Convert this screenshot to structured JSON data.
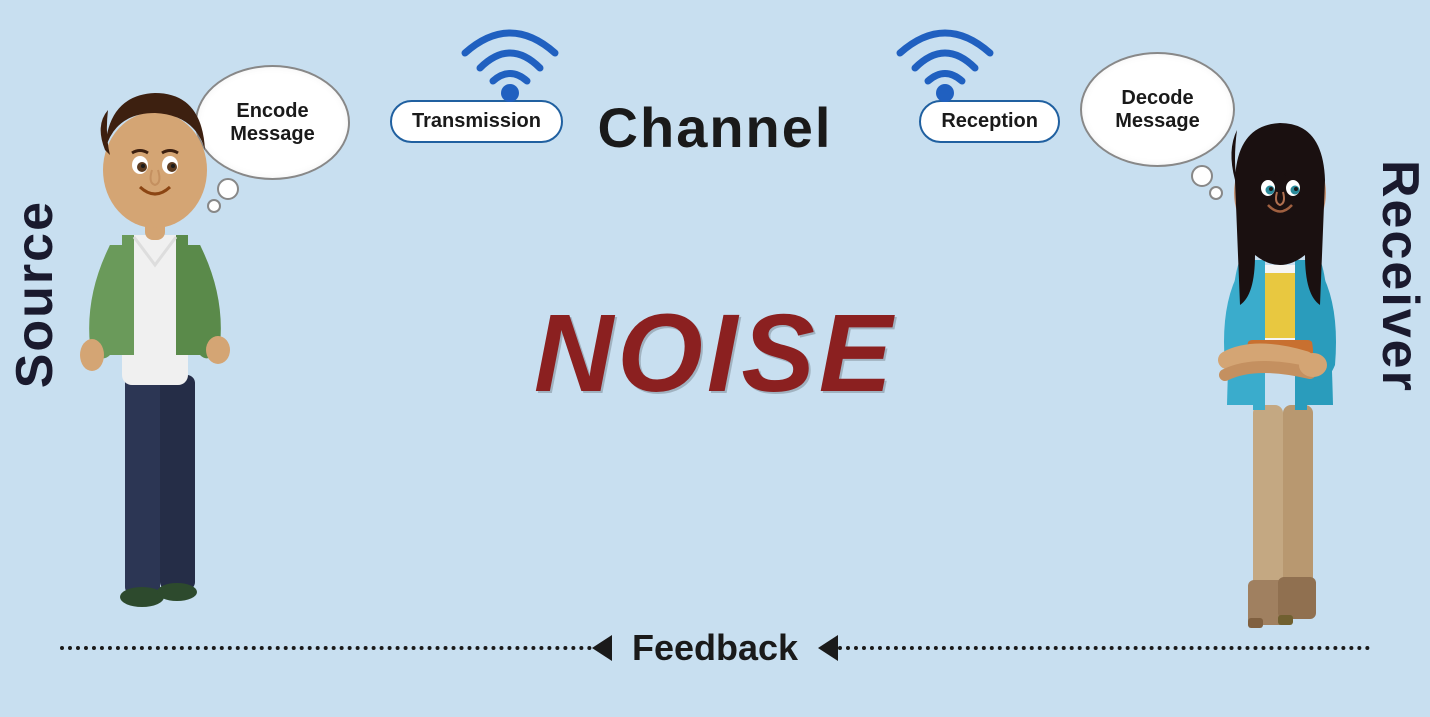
{
  "labels": {
    "source": "Source",
    "receiver": "Receiver",
    "channel": "Channel",
    "noise": "NOISE",
    "feedback": "Feedback",
    "encode_message": "Encode\nMessage",
    "decode_message": "Decode\nMessage",
    "transmission": "Transmission",
    "reception": "Reception"
  },
  "colors": {
    "background": "#c8dff0",
    "noise_text": "#8b2020",
    "wifi_blue": "#2060c0",
    "text_dark": "#1a1a1a",
    "bubble_bg": "white"
  }
}
